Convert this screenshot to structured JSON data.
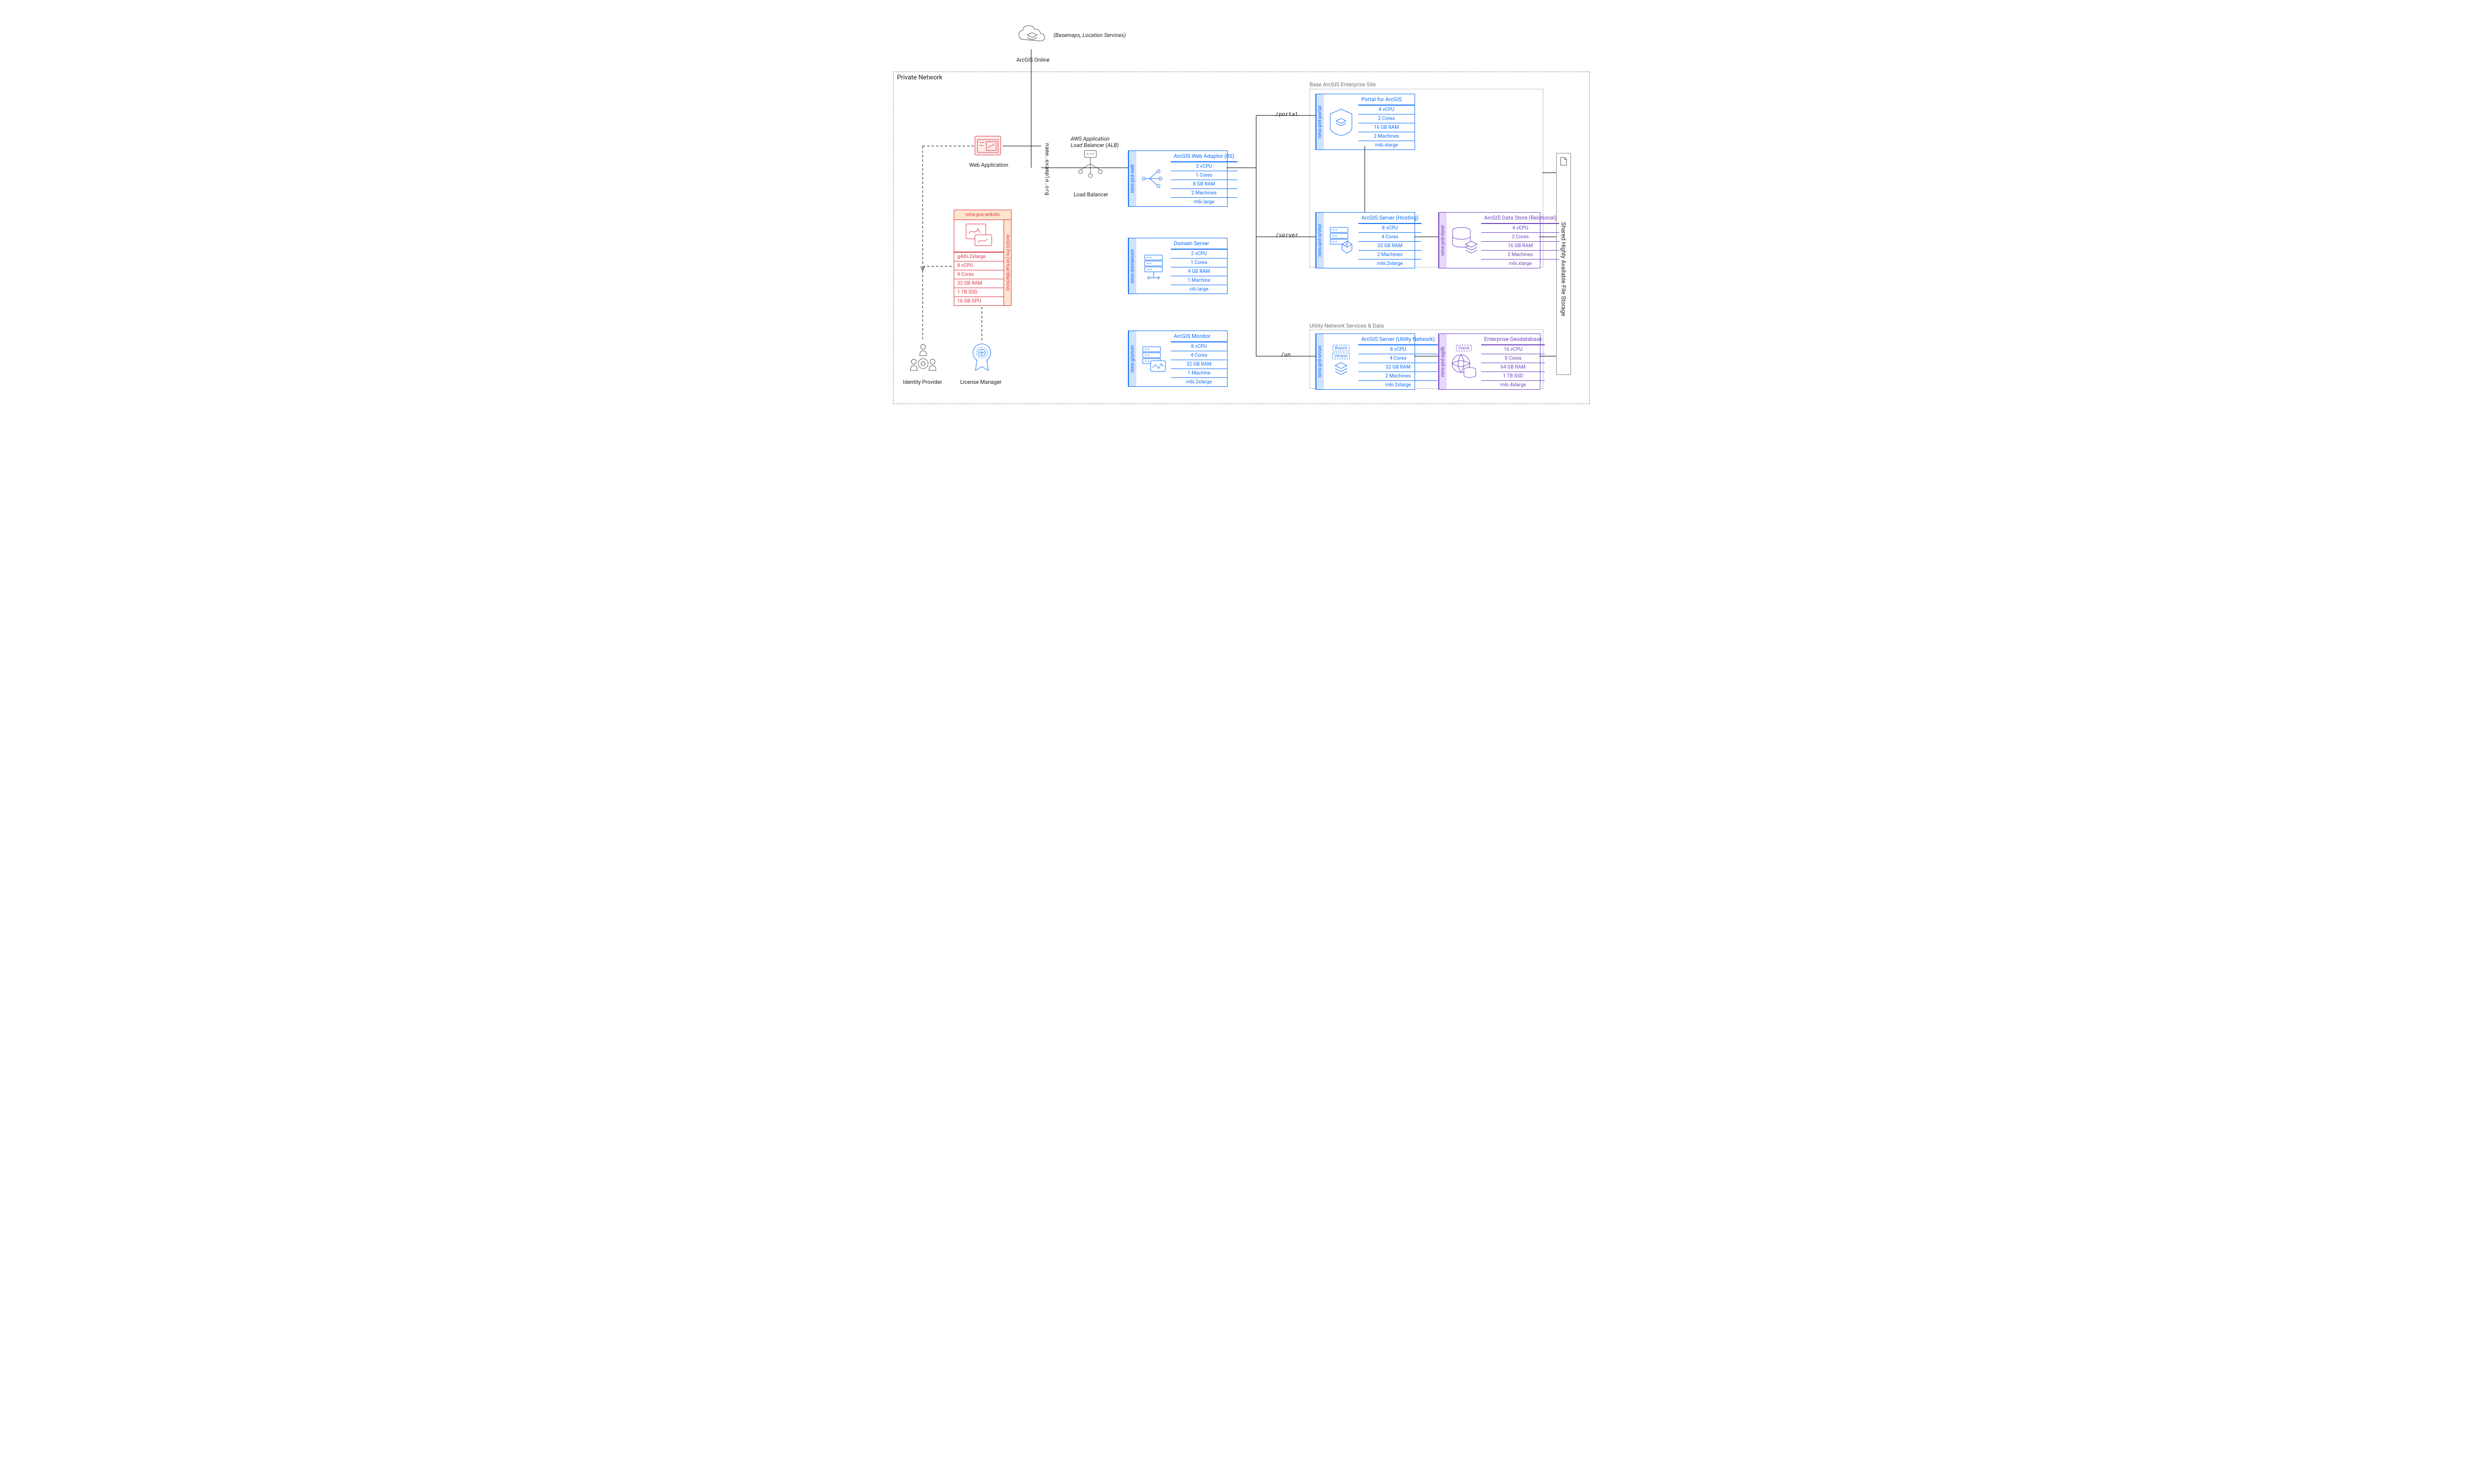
{
  "external": {
    "cloud_label": "ArcGIS Online",
    "cloud_note": "(Basemaps, Location Services)"
  },
  "private_network": {
    "title": "Private Network"
  },
  "dns": {
    "hostname": "name.example.org"
  },
  "routes": {
    "portal": "/portal",
    "server": "/server",
    "un": "/un"
  },
  "webapp": {
    "label": "Web Application"
  },
  "alb": {
    "title": "AWS Application",
    "sub": "Load Balancer (ALB)",
    "label": "Load Balancer"
  },
  "identity": {
    "label": "Identity Provider"
  },
  "license": {
    "label": "License Manager"
  },
  "groups": {
    "base": "Base ArcGIS Enterprise Site",
    "un": "Utility Network Services & Data"
  },
  "filestore": {
    "label": "Shared Highly Available File Storage"
  },
  "workstation": {
    "host": "nms-pro-wrkstn",
    "side": "ArcGIS Pro (Virtual Machine)",
    "specs": [
      "g4dn.2xlarge",
      "8 vCPU",
      "4 Cores",
      "32 GB RAM",
      "1 TB SSD",
      "16 GB GPU"
    ]
  },
  "webadaptor": {
    "host": "nms-prd-web",
    "title": "ArcGIS Web Adaptor (IIS)",
    "specs": [
      "2 vCPU",
      "1 Cores",
      "8 GB RAM",
      "2 Machines",
      "m6i.large"
    ]
  },
  "domainsvr": {
    "host": "nms-domainsvr",
    "title": "Domain Server",
    "specs": [
      "2 vCPU",
      "1 Cores",
      "4 GB RAM",
      "1 Machine",
      "c6i.large"
    ]
  },
  "gismon": {
    "host": "nms-gismon",
    "title": "ArcGIS Monitor",
    "specs": [
      "8 vCPU",
      "4 Cores",
      "32 GB RAM",
      "1 Machine",
      "m6i.2xlarge"
    ]
  },
  "portal": {
    "host": "nms-prd-portal",
    "title": "Portal for ArcGIS",
    "specs": [
      "4 vCPU",
      "2 Cores",
      "16 GB RAM",
      "2 Machines",
      "m6i.xlarge"
    ]
  },
  "hosting": {
    "host": "nms-prd-srvhst",
    "title": "ArcGIS Server (Hosting)",
    "specs": [
      "8 vCPU",
      "4 Cores",
      "32 GB RAM",
      "2 Machines",
      "m6i.2xlarge"
    ]
  },
  "dsrel": {
    "host": "nms-prd-dsrel",
    "title": "ArcGIS Data Store (Relational)",
    "specs": [
      "4 vCPU",
      "2 Cores",
      "16 GB RAM",
      "2 Machines",
      "m6i.xlarge"
    ]
  },
  "srvun": {
    "host": "nms-prd-srvun",
    "title": "ArcGIS Server (Utility Network)",
    "badges": [
      "Branch",
      "Version"
    ],
    "specs": [
      "8 vCPU",
      "4 Cores",
      "32 GB RAM",
      "2 Machines",
      "m6i.2xlarge"
    ]
  },
  "egdb": {
    "host": "nms-prd-egdb",
    "title": "Enterprise Geodatabase",
    "tag": "Oracle",
    "specs": [
      "16 vCPU",
      "8 Cores",
      "64 GB RAM",
      "1 TB SSD",
      "m6i.4xlarge"
    ]
  }
}
